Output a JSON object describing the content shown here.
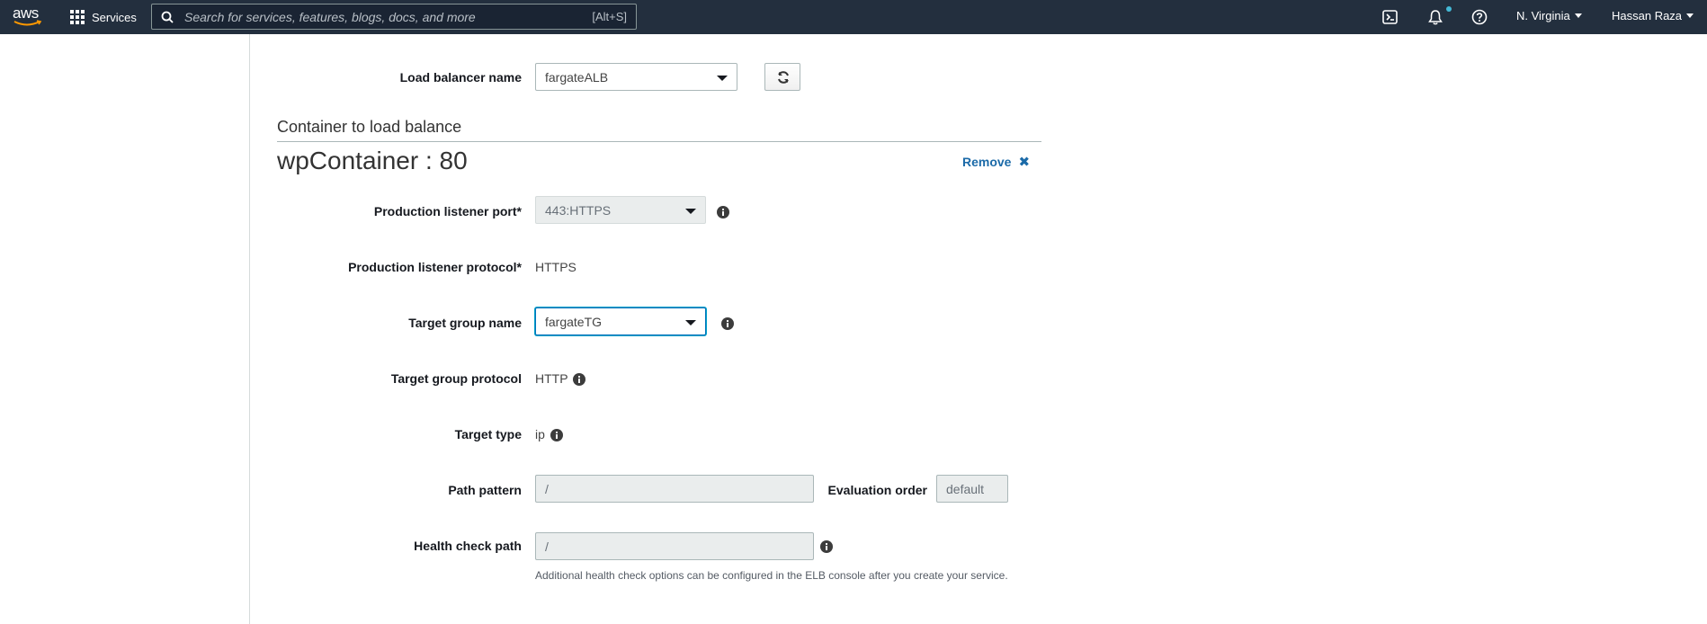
{
  "nav": {
    "logo_text": "aws",
    "services_label": "Services",
    "search_placeholder": "Search for services, features, blogs, docs, and more",
    "search_shortcut": "[Alt+S]",
    "region": "N. Virginia",
    "user": "Hassan Raza",
    "icons": [
      "cloudshell-icon",
      "bell-icon",
      "help-icon"
    ],
    "notification_dot_color": "#44b9d6"
  },
  "form": {
    "load_balancer": {
      "label": "Load balancer name",
      "value": "fargateALB"
    },
    "section_title": "Container to load balance",
    "container_title": "wpContainer : 80",
    "remove_label": "Remove",
    "production_listener_port": {
      "label": "Production listener port",
      "required_mark": "*",
      "value": "443:HTTPS"
    },
    "production_listener_protocol": {
      "label": "Production listener protocol",
      "required_mark": "*",
      "value": "HTTPS"
    },
    "target_group_name": {
      "label": "Target group name",
      "value": "fargateTG"
    },
    "target_group_protocol": {
      "label": "Target group protocol",
      "value": "HTTP"
    },
    "target_type": {
      "label": "Target type",
      "value": "ip"
    },
    "path_pattern": {
      "label": "Path pattern",
      "value": "/"
    },
    "evaluation_order": {
      "label": "Evaluation order",
      "value": "default"
    },
    "health_check_path": {
      "label": "Health check path",
      "value": "/",
      "help": "Additional health check options can be configured in the ELB console after you create your service."
    }
  },
  "colors": {
    "nav_bg": "#232f3e",
    "link": "#1b6aa8",
    "focus": "#0073bb"
  }
}
